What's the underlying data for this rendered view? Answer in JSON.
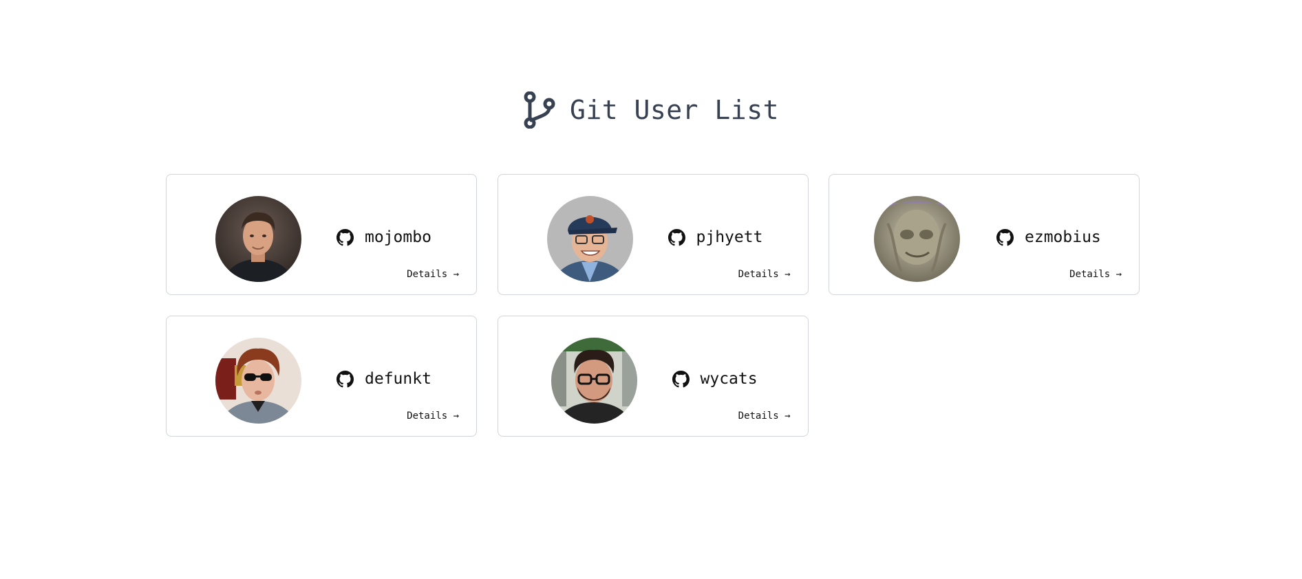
{
  "header": {
    "title": "Git User List",
    "icon": "git-branch-icon",
    "color": "#374151"
  },
  "users": [
    {
      "username": "mojombo",
      "details_label": "Details →",
      "avatar": "user-avatar"
    },
    {
      "username": "pjhyett",
      "details_label": "Details →",
      "avatar": "user-avatar"
    },
    {
      "username": "ezmobius",
      "details_label": "Details →",
      "avatar": "user-avatar"
    },
    {
      "username": "defunkt",
      "details_label": "Details →",
      "avatar": "user-avatar"
    },
    {
      "username": "wycats",
      "details_label": "Details →",
      "avatar": "user-avatar"
    }
  ],
  "icons": {
    "github": "github-icon"
  },
  "colors": {
    "card_border": "#d1d5db",
    "text": "#111111"
  }
}
